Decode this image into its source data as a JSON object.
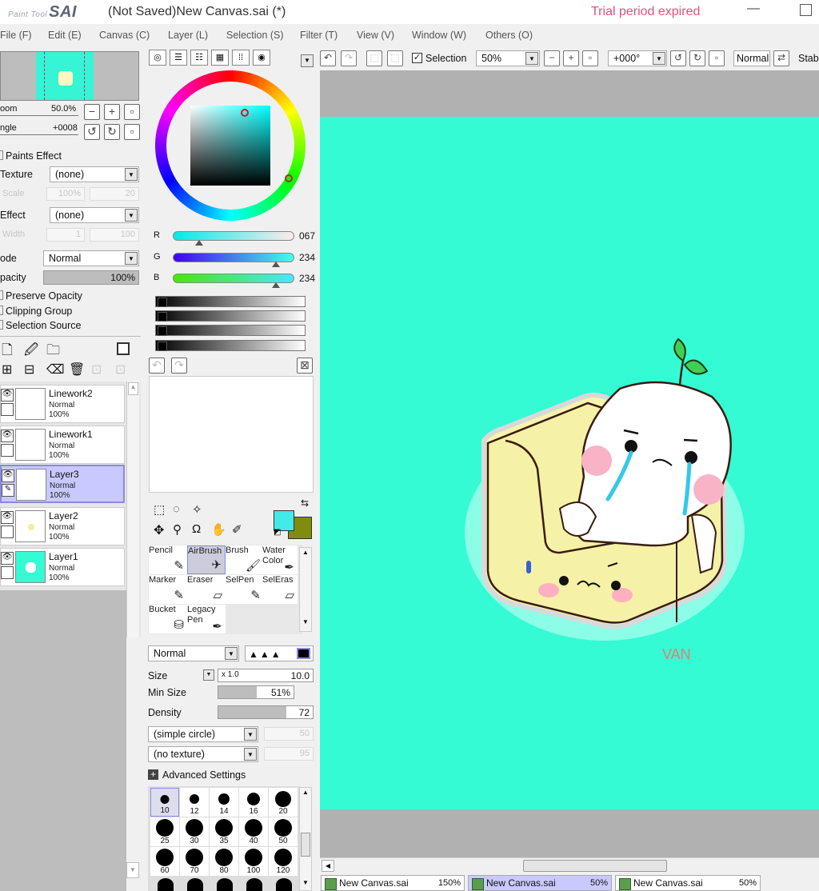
{
  "window": {
    "logo_small": "Paint Tool",
    "logo_big": "SAI",
    "title": "(Not Saved)New Canvas.sai (*)",
    "trial": "Trial period expired",
    "min_glyph": "—"
  },
  "menu": [
    "File (F)",
    "Edit (E)",
    "Canvas (C)",
    "Layer (L)",
    "Selection (S)",
    "Filter (T)",
    "View (V)",
    "Window (W)",
    "Others (O)"
  ],
  "navigator": {
    "zoom_label": "oom",
    "zoom_value": "50.0%",
    "angle_label": "ngle",
    "angle_value": "+0008"
  },
  "layer_props": {
    "paints_effect": "Paints Effect",
    "texture_label": "Texture",
    "texture_value": "(none)",
    "scale_label": "Scale",
    "scale_value": "100%",
    "scale_num": "20",
    "effect_label": "Effect",
    "effect_value": "(none)",
    "width_label": "Width",
    "width_value": "1",
    "width_num": "100",
    "mode_label": "ode",
    "mode_value": "Normal",
    "opacity_label": "pacity",
    "opacity_value": "100%",
    "preserve_opacity": "Preserve Opacity",
    "clipping_group": "Clipping Group",
    "selection_source": "Selection Source"
  },
  "layers": [
    {
      "name": "Linework2",
      "mode": "Normal",
      "opacity": "100%",
      "selected": false
    },
    {
      "name": "Linework1",
      "mode": "Normal",
      "opacity": "100%",
      "selected": false
    },
    {
      "name": "Layer3",
      "mode": "Normal",
      "opacity": "100%",
      "selected": true
    },
    {
      "name": "Layer2",
      "mode": "Normal",
      "opacity": "100%",
      "selected": false
    },
    {
      "name": "Layer1",
      "mode": "Normal",
      "opacity": "100%",
      "selected": false
    }
  ],
  "color": {
    "r_label": "R",
    "r": "067",
    "g_label": "G",
    "g": "234",
    "b_label": "B",
    "b": "234",
    "primary": "#43eaea",
    "secondary": "#7f8c0e",
    "canvas_bg": "#34fbd4"
  },
  "tools": [
    {
      "name": "Pencil",
      "glyph": "✎"
    },
    {
      "name": "AirBrush",
      "glyph": "✈"
    },
    {
      "name": "Brush",
      "glyph": "🖌"
    },
    {
      "name": "Water Color",
      "glyph": "✒"
    },
    {
      "name": "Marker",
      "glyph": "✎"
    },
    {
      "name": "Eraser",
      "glyph": "▱"
    },
    {
      "name": "SelPen",
      "glyph": "✎"
    },
    {
      "name": "SelEras",
      "glyph": "▱"
    },
    {
      "name": "Bucket",
      "glyph": "⛁"
    },
    {
      "name": "Legacy Pen",
      "glyph": "✒"
    }
  ],
  "brush": {
    "blend_mode": "Normal",
    "size_label": "Size",
    "size_mult": "x 1.0",
    "size_value": "10.0",
    "min_size_label": "Min Size",
    "min_size_value": "51%",
    "min_size_level": 0.51,
    "density_label": "Density",
    "density_value": "72",
    "density_level": 0.72,
    "shape": "(simple circle)",
    "shape_num": "50",
    "texture": "(no texture)",
    "texture_num": "95",
    "advanced": "Advanced Settings",
    "sizes": [
      "10",
      "12",
      "14",
      "16",
      "20",
      "25",
      "30",
      "35",
      "40",
      "50",
      "60",
      "70",
      "80",
      "100",
      "120"
    ]
  },
  "toolbar": {
    "selection_label": "Selection",
    "zoom_value": "50%",
    "angle_value": "+000°",
    "blend": "Normal",
    "stab_label": "Stab"
  },
  "artwork": {
    "signature": "VAN"
  },
  "tabs": [
    {
      "name": "New Canvas.sai",
      "zoom": "150%",
      "active": false
    },
    {
      "name": "New Canvas.sai",
      "zoom": "50%",
      "active": true
    },
    {
      "name": "New Canvas.sai",
      "zoom": "50%",
      "active": false
    }
  ]
}
